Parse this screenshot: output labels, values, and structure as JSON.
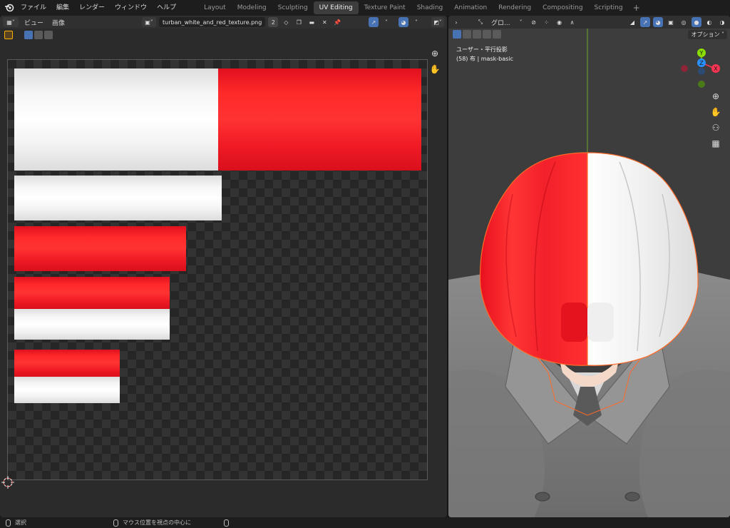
{
  "menu": {
    "items": [
      "ファイル",
      "編集",
      "レンダー",
      "ウィンドウ",
      "ヘルプ"
    ]
  },
  "workspaces": {
    "tabs": [
      "Layout",
      "Modeling",
      "Sculpting",
      "UV Editing",
      "Texture Paint",
      "Shading",
      "Animation",
      "Rendering",
      "Compositing",
      "Scripting"
    ],
    "active": "UV Editing",
    "add_label": "+"
  },
  "uv_editor": {
    "view_label": "ビュー",
    "image_label": "画像",
    "image_name": "turban_white_and_red_texture.png",
    "users_count": "2"
  },
  "viewport": {
    "orientation_label": "グロ...",
    "options_label": "オプション",
    "view_name": "ユーザー・平行投影",
    "object_info": "(58) 布 | mask-basic",
    "gizmo_axes": [
      "Y",
      "Z",
      "X"
    ]
  },
  "statusbar": {
    "select_label": "選択",
    "center_view_label": "マウス位置を視点の中心に"
  },
  "colors": {
    "accent_blue": "#4772b3",
    "turban_red": "#ff2a2a",
    "turban_white": "#f8f8f8",
    "selection_outline": "#ff6a2a",
    "axis_x": "#ff3352",
    "axis_y": "#8bdc00",
    "axis_z": "#2890ff"
  }
}
